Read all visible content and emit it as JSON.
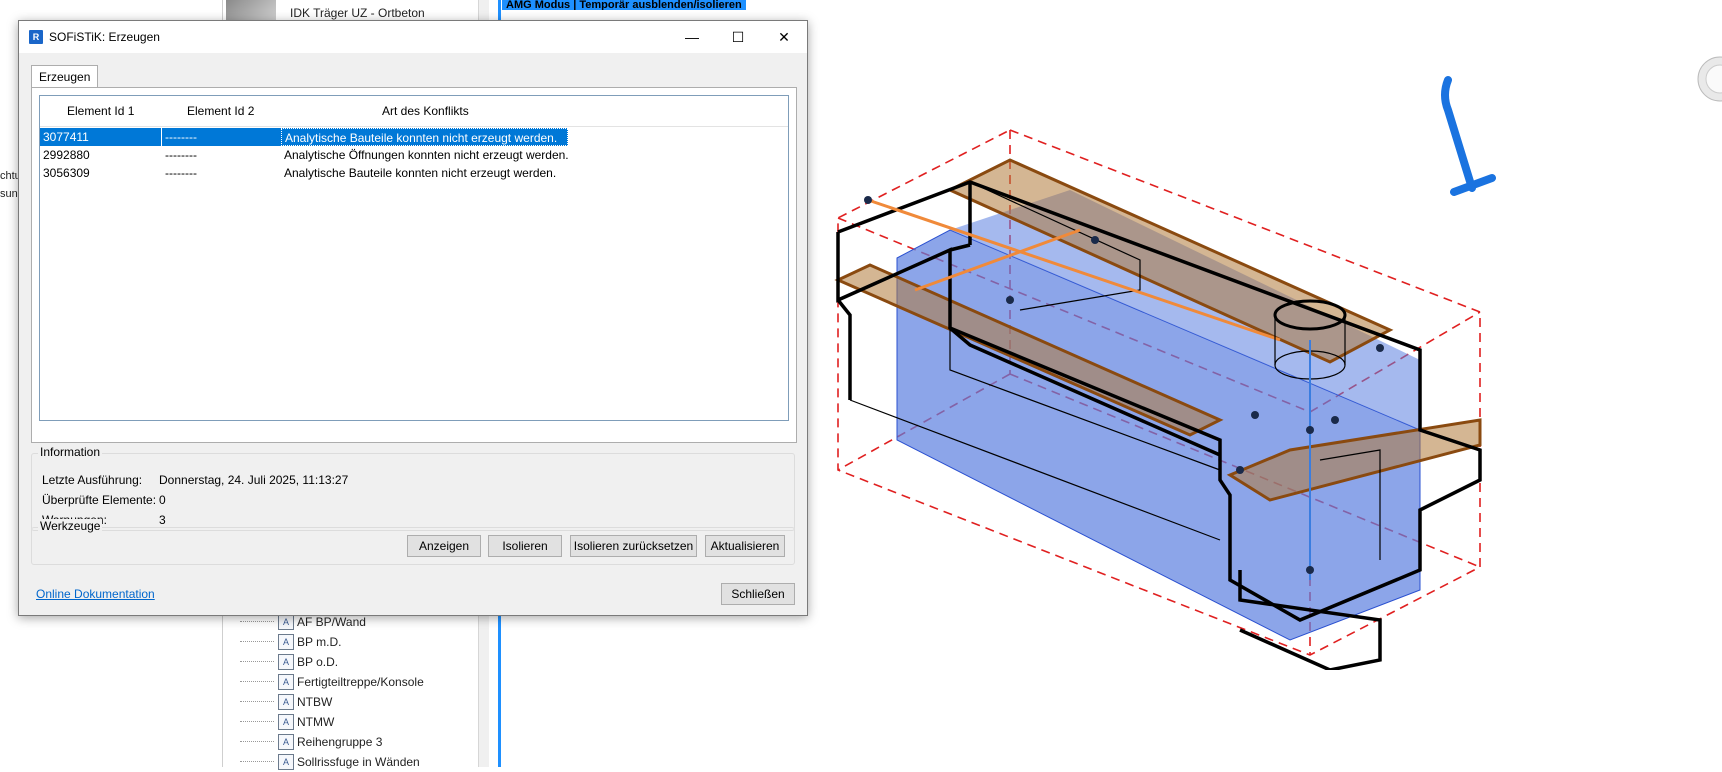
{
  "background": {
    "left_fragments": [
      "chtu",
      "sung"
    ],
    "browser_top_item": "IDK Träger UZ - Ortbeton",
    "view_banner": "AMG Modus | Temporär ausblenden/isolieren",
    "tree_items": [
      {
        "label": "AF BP/Wand",
        "icon": "family-icon"
      },
      {
        "label": "BP m.D.",
        "icon": "family-icon"
      },
      {
        "label": "BP o.D.",
        "icon": "family-icon"
      },
      {
        "label": "Fertigteiltreppe/Konsole",
        "icon": "family-icon"
      },
      {
        "label": "NTBW",
        "icon": "family-icon"
      },
      {
        "label": "NTMW",
        "icon": "family-icon"
      },
      {
        "label": "Reihengruppe 3",
        "icon": "family-icon"
      },
      {
        "label": "Sollrissfuge in Wänden",
        "icon": "family-icon"
      }
    ]
  },
  "dialog": {
    "app_icon_letter": "R",
    "title": "SOFiSTiK: Erzeugen",
    "window_buttons": {
      "minimize": "—",
      "maximize": "☐",
      "close": "✕"
    },
    "tab_label": "Erzeugen",
    "table": {
      "columns": [
        "Element Id 1",
        "Element Id 2",
        "Art des Konflikts"
      ],
      "rows": [
        {
          "id1": "3077411",
          "id2": "--------",
          "conflict": "Analytische Bauteile konnten nicht erzeugt werden.",
          "selected": true
        },
        {
          "id1": "2992880",
          "id2": "--------",
          "conflict": "Analytische Öffnungen konnten nicht erzeugt werden.",
          "selected": false
        },
        {
          "id1": "3056309",
          "id2": "--------",
          "conflict": "Analytische Bauteile konnten nicht erzeugt werden.",
          "selected": false
        }
      ]
    },
    "information": {
      "label": "Information",
      "last_run_label": "Letzte Ausführung:",
      "last_run_value": "Donnerstag, 24. Juli 2025, 11:13:27",
      "checked_label": "Überprüfte Elemente:",
      "checked_value": "0",
      "warnings_label": "Warnungen:",
      "warnings_value": "3"
    },
    "tools": {
      "label": "Werkzeuge",
      "show": "Anzeigen",
      "isolate": "Isolieren",
      "reset_isolate": "Isolieren zurücksetzen",
      "refresh": "Aktualisieren"
    },
    "online_doc": "Online Dokumentation",
    "close": "Schließen"
  },
  "colors": {
    "selection": "#0078d7",
    "view_border": "#1e90ff",
    "section_box": "#e02020",
    "volume_fill": "#5b7fe0",
    "slab_fill": "#b07a3a",
    "link": "#0066cc"
  }
}
